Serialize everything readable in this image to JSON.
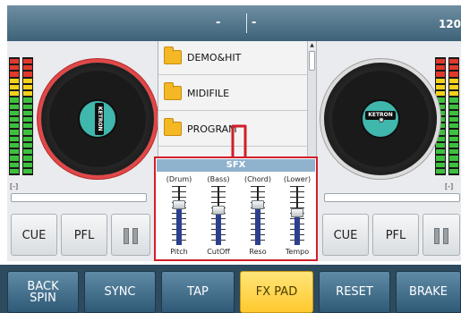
{
  "header": {
    "left_text": "-",
    "right_text": "-",
    "bpm": "120"
  },
  "file_list": {
    "items": [
      {
        "label": "DEMO&HIT"
      },
      {
        "label": "MIDIFILE"
      },
      {
        "label": "PROGRAM"
      }
    ]
  },
  "decks": {
    "left": {
      "brand": "KETRON",
      "marker": "[-]"
    },
    "right": {
      "brand": "KETRON",
      "marker": "[-]"
    }
  },
  "sfx": {
    "title": "SFX",
    "sliders": [
      {
        "top": "(Drum)",
        "bottom": "Pitch",
        "level": 0.72
      },
      {
        "top": "(Bass)",
        "bottom": "CutOff",
        "level": 0.6
      },
      {
        "top": "(Chord)",
        "bottom": "Reso",
        "level": 0.72
      },
      {
        "top": "(Lower)",
        "bottom": "Tempo",
        "level": 0.56
      }
    ]
  },
  "transport": {
    "left": {
      "cue": "CUE",
      "pfl": "PFL"
    },
    "right": {
      "cue": "CUE",
      "pfl": "PFL"
    }
  },
  "bottom_bar": {
    "buttons": [
      {
        "label": "BACK\nSPIN"
      },
      {
        "label": "SYNC"
      },
      {
        "label": "TAP"
      },
      {
        "label": "FX PAD",
        "active": true
      },
      {
        "label": "RESET"
      },
      {
        "label": "BRAKE"
      }
    ]
  },
  "colors": {
    "accent_red": "#d21e28",
    "active_yellow": "#ffc92e",
    "bar_blue": "#2d4a5e",
    "label_teal": "#3fb7ad"
  }
}
